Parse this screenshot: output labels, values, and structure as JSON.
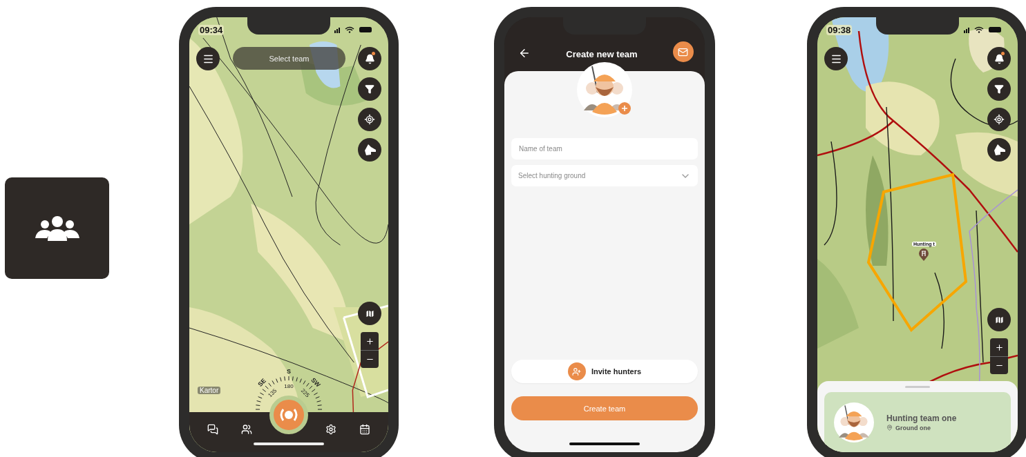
{
  "map_screen": {
    "time": "09:34",
    "team_selector": {
      "placeholder": "Select team"
    },
    "notification": true,
    "attribution": "Kartor",
    "compass": {
      "directions": [
        "SE",
        "S",
        "SW"
      ],
      "degrees": [
        "135",
        "180",
        "225"
      ]
    },
    "nav": [
      {
        "kind": "chat"
      },
      {
        "kind": "team"
      },
      {
        "kind": "record"
      },
      {
        "kind": "settings"
      },
      {
        "kind": "calendar"
      }
    ]
  },
  "create_team_screen": {
    "title": "Create new team",
    "name_field": {
      "placeholder": "Name of team"
    },
    "ground_select": {
      "placeholder": "Select hunting ground"
    },
    "invite_button": "Invite hunters",
    "create_button": "Create team"
  },
  "team_screen": {
    "time": "09:38",
    "notification": true,
    "marker_label": "Hunting t",
    "team_card": {
      "name": "Hunting team one",
      "ground": "Ground one"
    }
  }
}
